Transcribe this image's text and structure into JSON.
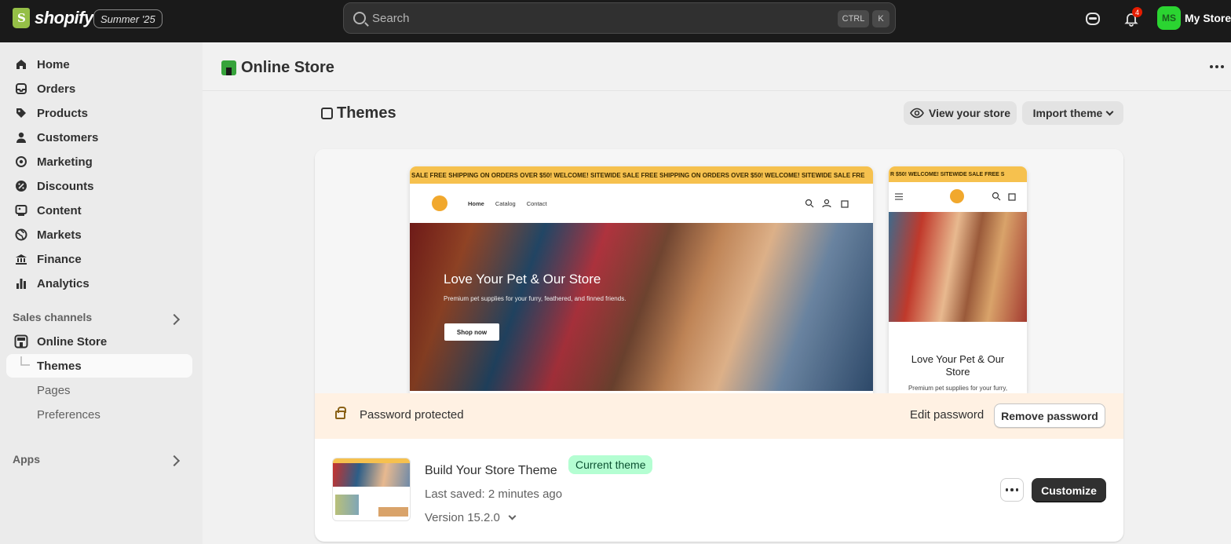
{
  "topbar": {
    "logo_text": "shopify",
    "edition": "Summer '25",
    "search_placeholder": "Search",
    "kbd_ctrl": "CTRL",
    "kbd_k": "K",
    "notification_count": "4",
    "avatar_initials": "MS",
    "store_name": "My Store"
  },
  "sidebar": {
    "items": [
      {
        "label": "Home",
        "icon": "home-icon"
      },
      {
        "label": "Orders",
        "icon": "inbox-icon"
      },
      {
        "label": "Products",
        "icon": "tag-icon"
      },
      {
        "label": "Customers",
        "icon": "person-icon"
      },
      {
        "label": "Marketing",
        "icon": "target-icon"
      },
      {
        "label": "Discounts",
        "icon": "discount-icon"
      },
      {
        "label": "Content",
        "icon": "image-icon"
      },
      {
        "label": "Markets",
        "icon": "globe-icon"
      },
      {
        "label": "Finance",
        "icon": "bank-icon"
      },
      {
        "label": "Analytics",
        "icon": "bar-chart-icon"
      }
    ],
    "sales_channels_label": "Sales channels",
    "online_store_label": "Online Store",
    "sub_items": [
      "Themes",
      "Pages",
      "Preferences"
    ],
    "apps_label": "Apps"
  },
  "header": {
    "title": "Online Store"
  },
  "themes": {
    "title": "Themes",
    "view_store_label": "View your store",
    "import_theme_label": "Import theme"
  },
  "preview": {
    "banner_text": "SALE   FREE SHIPPING ON ORDERS OVER $50!   WELCOME!   SITEWIDE SALE   FREE SHIPPING ON ORDERS OVER $50!   WELCOME!   SITEWIDE SALE   FRE",
    "mobile_banner_text": "R $50!   WELCOME!   SITEWIDE SALE   FREE S",
    "nav_links": [
      "Home",
      "Catalog",
      "Contact"
    ],
    "hero_title": "Love Your Pet & Our Store",
    "hero_subtitle": "Premium pet supplies for your furry, feathered, and finned friends.",
    "hero_button": "Shop now",
    "mobile_title": "Love Your Pet & Our Store",
    "mobile_subtitle": "Premium pet supplies for your furry,"
  },
  "password": {
    "text": "Password protected",
    "edit_label": "Edit password",
    "remove_label": "Remove password"
  },
  "theme": {
    "name": "Build Your Store Theme",
    "badge": "Current theme",
    "last_saved": "Last saved: 2 minutes ago",
    "version": "Version 15.2.0",
    "customize_label": "Customize"
  },
  "colors": {
    "topbar": "#1a1a1a",
    "accent_green": "#2bd431",
    "badge_bg": "#b4fed2",
    "password_bar": "#fff1e3",
    "banner_yellow": "#f6c14e"
  }
}
